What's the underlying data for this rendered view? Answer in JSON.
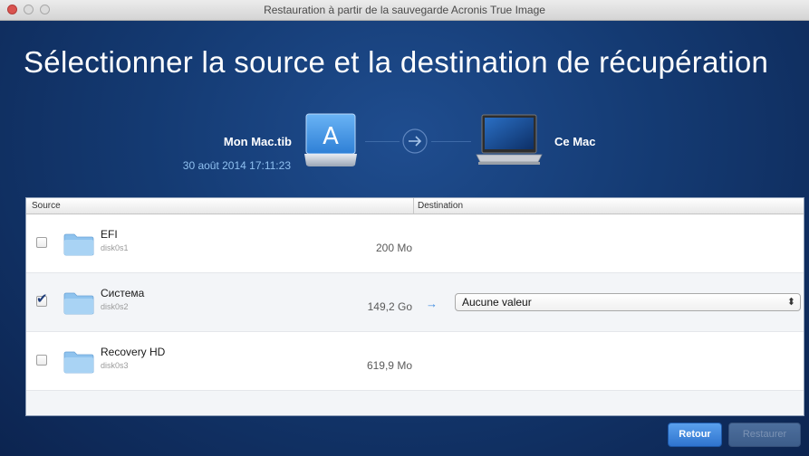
{
  "window": {
    "title": "Restauration à partir de la sauvegarde Acronis True Image"
  },
  "heading": "Sélectionner la source et la destination de récupération",
  "source": {
    "name": "Mon Mac.tib",
    "date": "30 août 2014 17:11:23",
    "icon": "backup-drive-icon",
    "icon_letter": "A"
  },
  "destination": {
    "name": "Ce Mac",
    "icon": "laptop-icon"
  },
  "table": {
    "columns": {
      "source": "Source",
      "destination": "Destination"
    },
    "rows": [
      {
        "name": "EFI",
        "disk": "disk0s1",
        "size": "200 Mo",
        "checked": false,
        "destination": ""
      },
      {
        "name": "Система",
        "disk": "disk0s2",
        "size": "149,2 Go",
        "checked": true,
        "destination": "Aucune valeur",
        "arrow": "→"
      },
      {
        "name": "Recovery HD",
        "disk": "disk0s3",
        "size": "619,9 Mo",
        "checked": false,
        "destination": ""
      }
    ]
  },
  "buttons": {
    "back": "Retour",
    "restore": "Restaurer"
  },
  "colors": {
    "background": "#143a72",
    "accent": "#2f74cf",
    "date_text": "#8fc0f0"
  }
}
